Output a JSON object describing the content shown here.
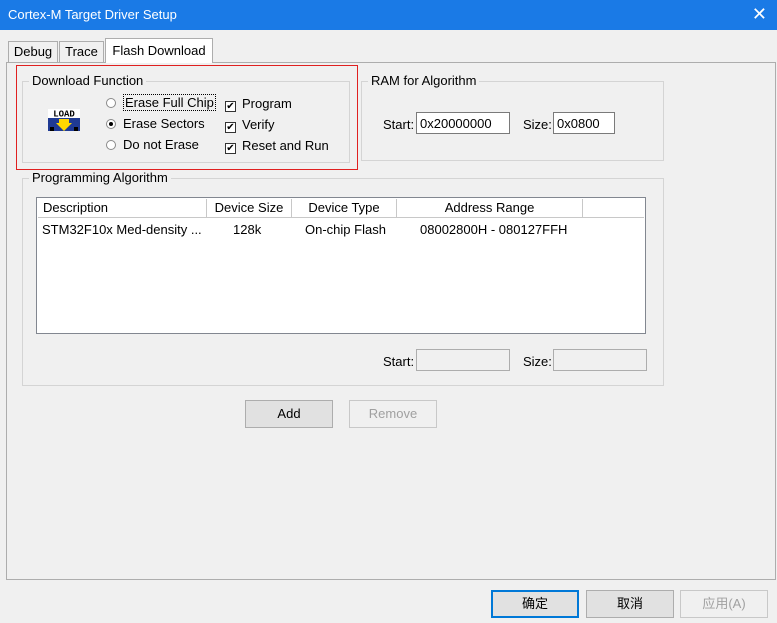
{
  "window": {
    "title": "Cortex-M Target Driver Setup",
    "close_glyph": "✕"
  },
  "tabs": [
    {
      "label": "Debug"
    },
    {
      "label": "Trace"
    },
    {
      "label": "Flash Download",
      "active": true
    }
  ],
  "download_function": {
    "legend": "Download Function",
    "icon": "load-icon",
    "icon_text": "LOAD",
    "radios": [
      {
        "label": "Erase Full Chip",
        "checked": false
      },
      {
        "label": "Erase Sectors",
        "checked": true
      },
      {
        "label": "Do not Erase",
        "checked": false
      }
    ],
    "checks": [
      {
        "label": "Program",
        "checked": true
      },
      {
        "label": "Verify",
        "checked": true
      },
      {
        "label": "Reset and Run",
        "checked": true
      }
    ]
  },
  "ram": {
    "legend": "RAM for Algorithm",
    "start_label": "Start:",
    "start_value": "0x20000000",
    "size_label": "Size:",
    "size_value": "0x0800"
  },
  "programming_algorithm": {
    "legend": "Programming Algorithm",
    "columns": [
      "Description",
      "Device Size",
      "Device Type",
      "Address Range"
    ],
    "rows": [
      {
        "description": "STM32F10x Med-density ...",
        "size": "128k",
        "type": "On-chip Flash",
        "range": "08002800H - 080127FFH"
      }
    ],
    "start_label": "Start:",
    "start_value": "",
    "size_label": "Size:",
    "size_value": ""
  },
  "buttons": {
    "add": "Add",
    "remove": "Remove",
    "ok": "确定",
    "cancel": "取消",
    "apply": "应用(A)"
  }
}
